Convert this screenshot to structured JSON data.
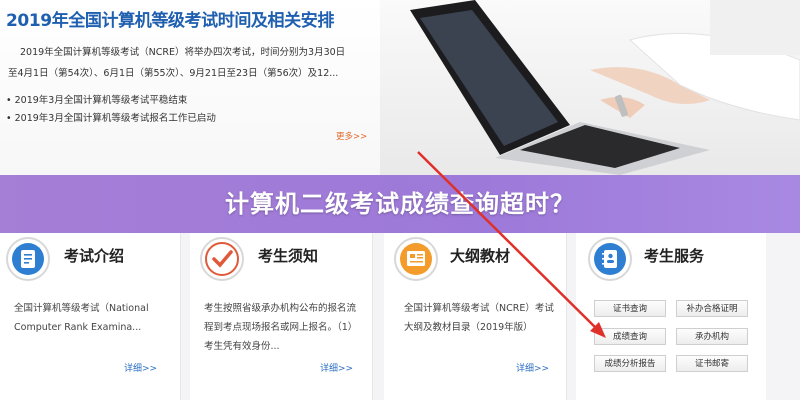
{
  "hero": {
    "title": "2019年全国计算机等级考试时间及相关安排",
    "paragraph": "2019年全国计算机等级考试（NCRE）将举办四次考试，时间分别为3月30日至4月1日（第54次）、6月1日（第55次）、9月21日至23日（第56次）及12...",
    "bullets": [
      "2019年3月全国计算机等级考试平稳结束",
      "2019年3月全国计算机等级考试报名工作已启动"
    ],
    "more_label": "更多>>"
  },
  "banner": {
    "text": "计算机二级考试成绩查询超时？"
  },
  "cards": [
    {
      "title": "考试介绍",
      "body": "全国计算机等级考试（National Computer Rank Examina...",
      "more": "详细>>",
      "icon": "clipboard-icon"
    },
    {
      "title": "考生须知",
      "body": "考生按照省级承办机构公布的报名流程到考点现场报名或网上报名。（1）考生凭有效身份...",
      "more": "详细>>",
      "icon": "check-icon"
    },
    {
      "title": "大纲教材",
      "body": "全国计算机等级考试（NCRE）考试大纲及教材目录（2019年版）",
      "more": "详细>>",
      "icon": "book-icon"
    },
    {
      "title": "考生服务",
      "icon": "notebook-icon"
    }
  ],
  "services": {
    "buttons": [
      "证书查询",
      "补办合格证明",
      "成绩查询",
      "承办机构",
      "成绩分析报告",
      "证书邮寄"
    ]
  },
  "colors": {
    "title_blue": "#1f5fb0",
    "banner_purple": "#a57ed6",
    "arrow_red": "#e0302a",
    "more_orange": "#e06a2b"
  }
}
